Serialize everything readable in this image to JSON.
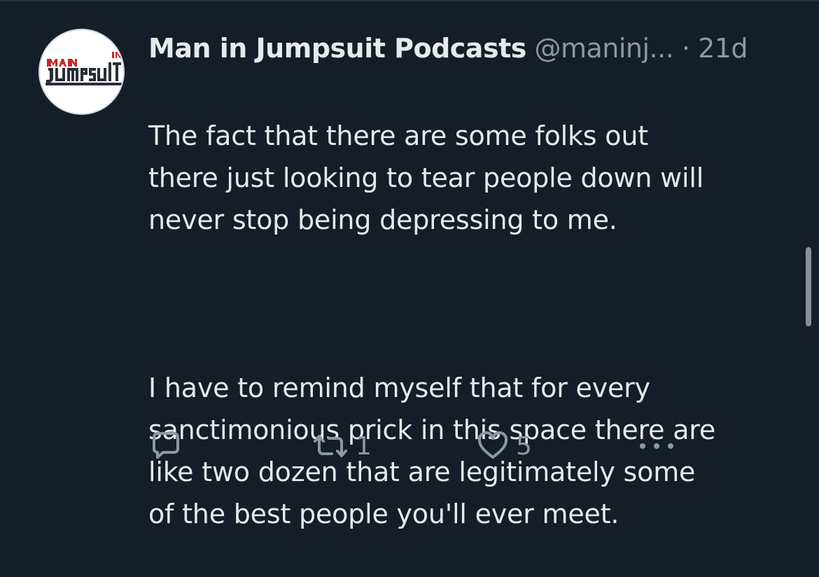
{
  "tweet": {
    "avatar_logo_text": "MAN IN JUMPSUIT",
    "display_name": "Man in Jumpsuit Podcasts",
    "handle": "@maninj...",
    "separator": "·",
    "time": "21d",
    "paragraphs": [
      "The fact that there are some folks out\nthere just looking to tear people down will\nnever stop being depressing to me.",
      "I have to remind myself that for every\nsanctimonious prick in this space there are\nlike two dozen that are legitimately some\nof the best people you'll ever meet."
    ]
  },
  "actions": {
    "reply": {
      "icon": "reply-icon",
      "count": ""
    },
    "retweet": {
      "icon": "retweet-icon",
      "count": "1"
    },
    "like": {
      "icon": "heart-icon",
      "count": "5"
    },
    "more": {
      "icon": "more-icon"
    }
  },
  "colors": {
    "background": "#151d28",
    "primary_text": "#e7e9ea",
    "secondary_text": "#8b98a5",
    "logo_red": "#c62828"
  }
}
